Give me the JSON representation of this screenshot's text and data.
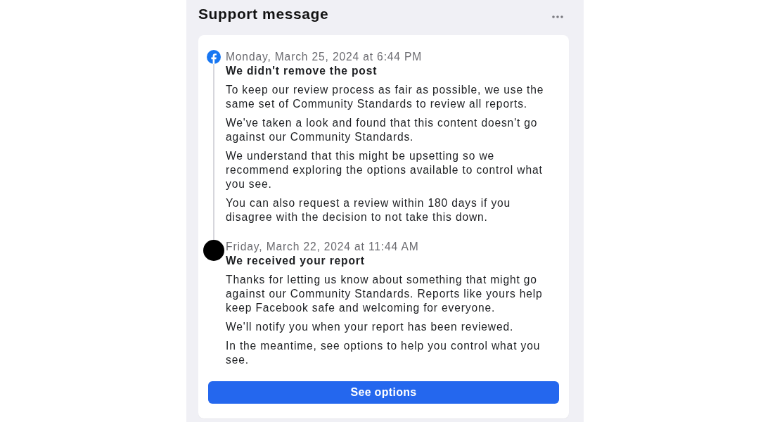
{
  "panel": {
    "title": "Support message"
  },
  "timeline": [
    {
      "kind": "logo",
      "date": "Monday, March 25, 2024 at 6:44 PM",
      "heading": "We didn't remove the post",
      "paragraphs": [
        "To keep our review process as fair as possible, we use the same set of Community Standards to review all reports.",
        "We've taken a look and found that this content doesn't go against our Community Standards.",
        "We understand that this might be upsetting so we recommend exploring the options available to control what you see.",
        "You can also request a review within 180 days if you disagree with the decision to not take this down."
      ]
    },
    {
      "kind": "dot",
      "date": "Friday, March 22, 2024 at 11:44 AM",
      "heading": "We received your report",
      "paragraphs": [
        "Thanks for letting us know about something that might go against our Community Standards. Reports like yours help keep Facebook safe and welcoming for everyone.",
        "We'll notify you when your report has been reviewed.",
        "In the meantime, see options to help you control what you see."
      ]
    }
  ],
  "button": {
    "label": "See options"
  }
}
